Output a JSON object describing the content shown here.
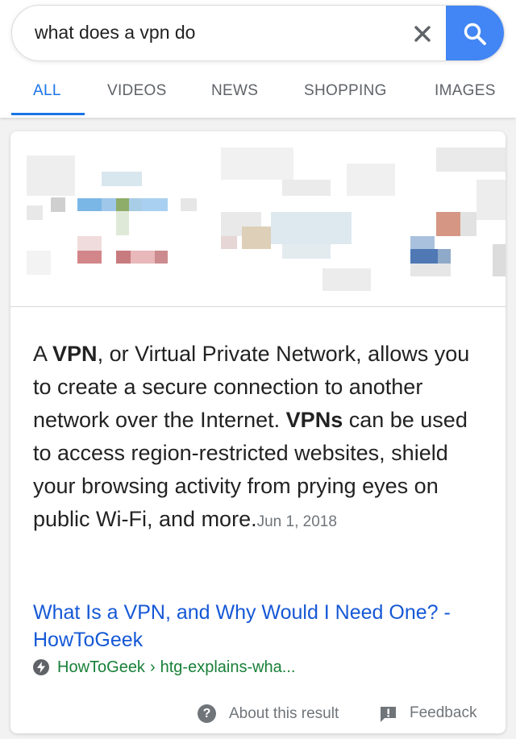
{
  "search": {
    "query": "what does a vpn do"
  },
  "tabs": [
    {
      "label": "ALL",
      "active": true
    },
    {
      "label": "VIDEOS",
      "active": false
    },
    {
      "label": "NEWS",
      "active": false
    },
    {
      "label": "SHOPPING",
      "active": false
    },
    {
      "label": "IMAGES",
      "active": false
    }
  ],
  "snippet": {
    "text_parts": [
      {
        "text": "A ",
        "bold": false
      },
      {
        "text": "VPN",
        "bold": true
      },
      {
        "text": ", or Virtual Private Network, allows you to create a secure connection to another network over the Internet. ",
        "bold": false
      },
      {
        "text": "VPNs",
        "bold": true
      },
      {
        "text": " can be used to access region-restricted websites, shield your browsing activity from prying eyes on public Wi-Fi, and more.",
        "bold": false
      }
    ],
    "date": "Jun 1, 2018"
  },
  "result": {
    "title": "What Is a VPN, and Why Would I Need One? - HowToGeek",
    "site": "HowToGeek",
    "path": "htg-explains-wha..."
  },
  "footer": {
    "about_label": "About this result",
    "feedback_label": "Feedback"
  },
  "icons": {
    "clear": "close-icon",
    "search": "search-icon",
    "amp": "amp-lightning-icon",
    "about": "help-circle-icon",
    "feedback": "feedback-icon"
  },
  "colors": {
    "accent": "#1a73e8",
    "search_button": "#4285f4",
    "link": "#1558d6",
    "url_green": "#188038",
    "muted": "#70757a"
  }
}
